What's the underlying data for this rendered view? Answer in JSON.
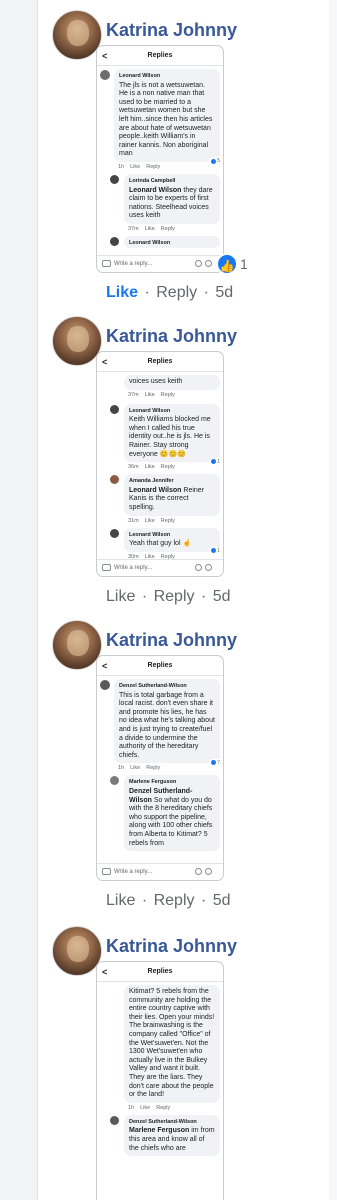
{
  "posts": [
    {
      "name": "Katrina Johnny",
      "replies_title": "Replies",
      "like_count": "1",
      "actions": {
        "like": "Like",
        "sep1": "·",
        "reply": "Reply",
        "sep2": "·",
        "time": "5d"
      },
      "footer_placeholder": "Write a reply...",
      "comments": [
        {
          "author": "Leonard Wilson",
          "mention": "",
          "text": "The jls is not a wetsuwetan. He is a non native man that used to be married to a wetsuwetan women but she left him..since then his articles are about hate of wetsuwetan people..keith William's in rainer kannis. Non aboriginal man",
          "time": "1h",
          "like": "Like",
          "reply": "Reply",
          "reactions": "5"
        },
        {
          "author": "Lorinda Campbell",
          "mention": "Leonard Wilson",
          "text": "they dare claim to be experts of first nations. Steelhead voices uses keith",
          "time": "37m",
          "like": "Like",
          "reply": "Reply"
        },
        {
          "author": "Leonard Wilson",
          "mention": "",
          "text": "",
          "time": "",
          "like": "",
          "reply": ""
        }
      ]
    },
    {
      "name": "Katrina Johnny",
      "replies_title": "Replies",
      "actions": {
        "like": "Like",
        "sep1": "·",
        "reply": "Reply",
        "sep2": "·",
        "time": "5d"
      },
      "footer_placeholder": "Write a reply...",
      "top_fragment": "voices uses keith",
      "top_meta": {
        "time": "37m",
        "like": "Like",
        "reply": "Reply"
      },
      "comments": [
        {
          "author": "Leonard Wilson",
          "mention": "",
          "text": "Keith Williams blocked me when I called his true identity out..he is jls. He is Rainer. Stay strong everyone 😊😊😊",
          "time": "36m",
          "like": "Like",
          "reply": "Reply",
          "reactions": "1"
        },
        {
          "author": "Amanda Jennifer",
          "mention": "Leonard Wilson",
          "text": "Reiner Kanis is the correct spelling.",
          "time": "31m",
          "like": "Like",
          "reply": "Reply"
        },
        {
          "author": "Leonard Wilson",
          "mention": "",
          "text": "Yeah that guy lol ☝",
          "time": "30m",
          "like": "Like",
          "reply": "Reply",
          "reactions": "1"
        }
      ]
    },
    {
      "name": "Katrina Johnny",
      "replies_title": "Replies",
      "actions": {
        "like": "Like",
        "sep1": "·",
        "reply": "Reply",
        "sep2": "·",
        "time": "5d"
      },
      "footer_placeholder": "Write a reply...",
      "comments": [
        {
          "author": "Denzel Sutherland-Wilson",
          "mention": "",
          "text": "This is total garbage from a local racist. don't even share it and promote his lies, he has no idea what he's talking about and is just trying to create/fuel a divide to undermine the authority of the hereditary chiefs.",
          "time": "1h",
          "like": "Like",
          "reply": "Reply",
          "reactions": "7"
        },
        {
          "author": "Marlene Ferguson",
          "mention": "Denzel Sutherland-Wilson",
          "text": "So what do you do with the 8 hereditary chiefs who support the pipeline, along with 100 other chiefs from Alberta to Kitimat? 5 rebels from",
          "time": "",
          "like": "",
          "reply": ""
        }
      ]
    },
    {
      "name": "Katrina Johnny",
      "replies_title": "Replies",
      "comments": [
        {
          "author": "",
          "mention": "",
          "text": "Kitimat? 5 rebels from the community are holding the entire country captive with their lies. Open your minds! The brainwashing is the company called \"Office\" of the Wet'suwet'en. Not the 1300 Wet'suwet'en who actually live in the Bulkey Valley and want it built. They are the liars. They don't care about the people or the land!",
          "time": "1h",
          "like": "Like",
          "reply": "Reply"
        },
        {
          "author": "Denzel Sutherland-Wilson",
          "mention": "Marlene Ferguson",
          "text": "im from this area and know all of the chiefs who are",
          "time": "",
          "like": "",
          "reply": ""
        }
      ]
    }
  ],
  "colors": {
    "name": "#385898",
    "like_blue": "#1877f2",
    "meta_gray": "#65676b",
    "bubble": "#f0f2f5"
  }
}
